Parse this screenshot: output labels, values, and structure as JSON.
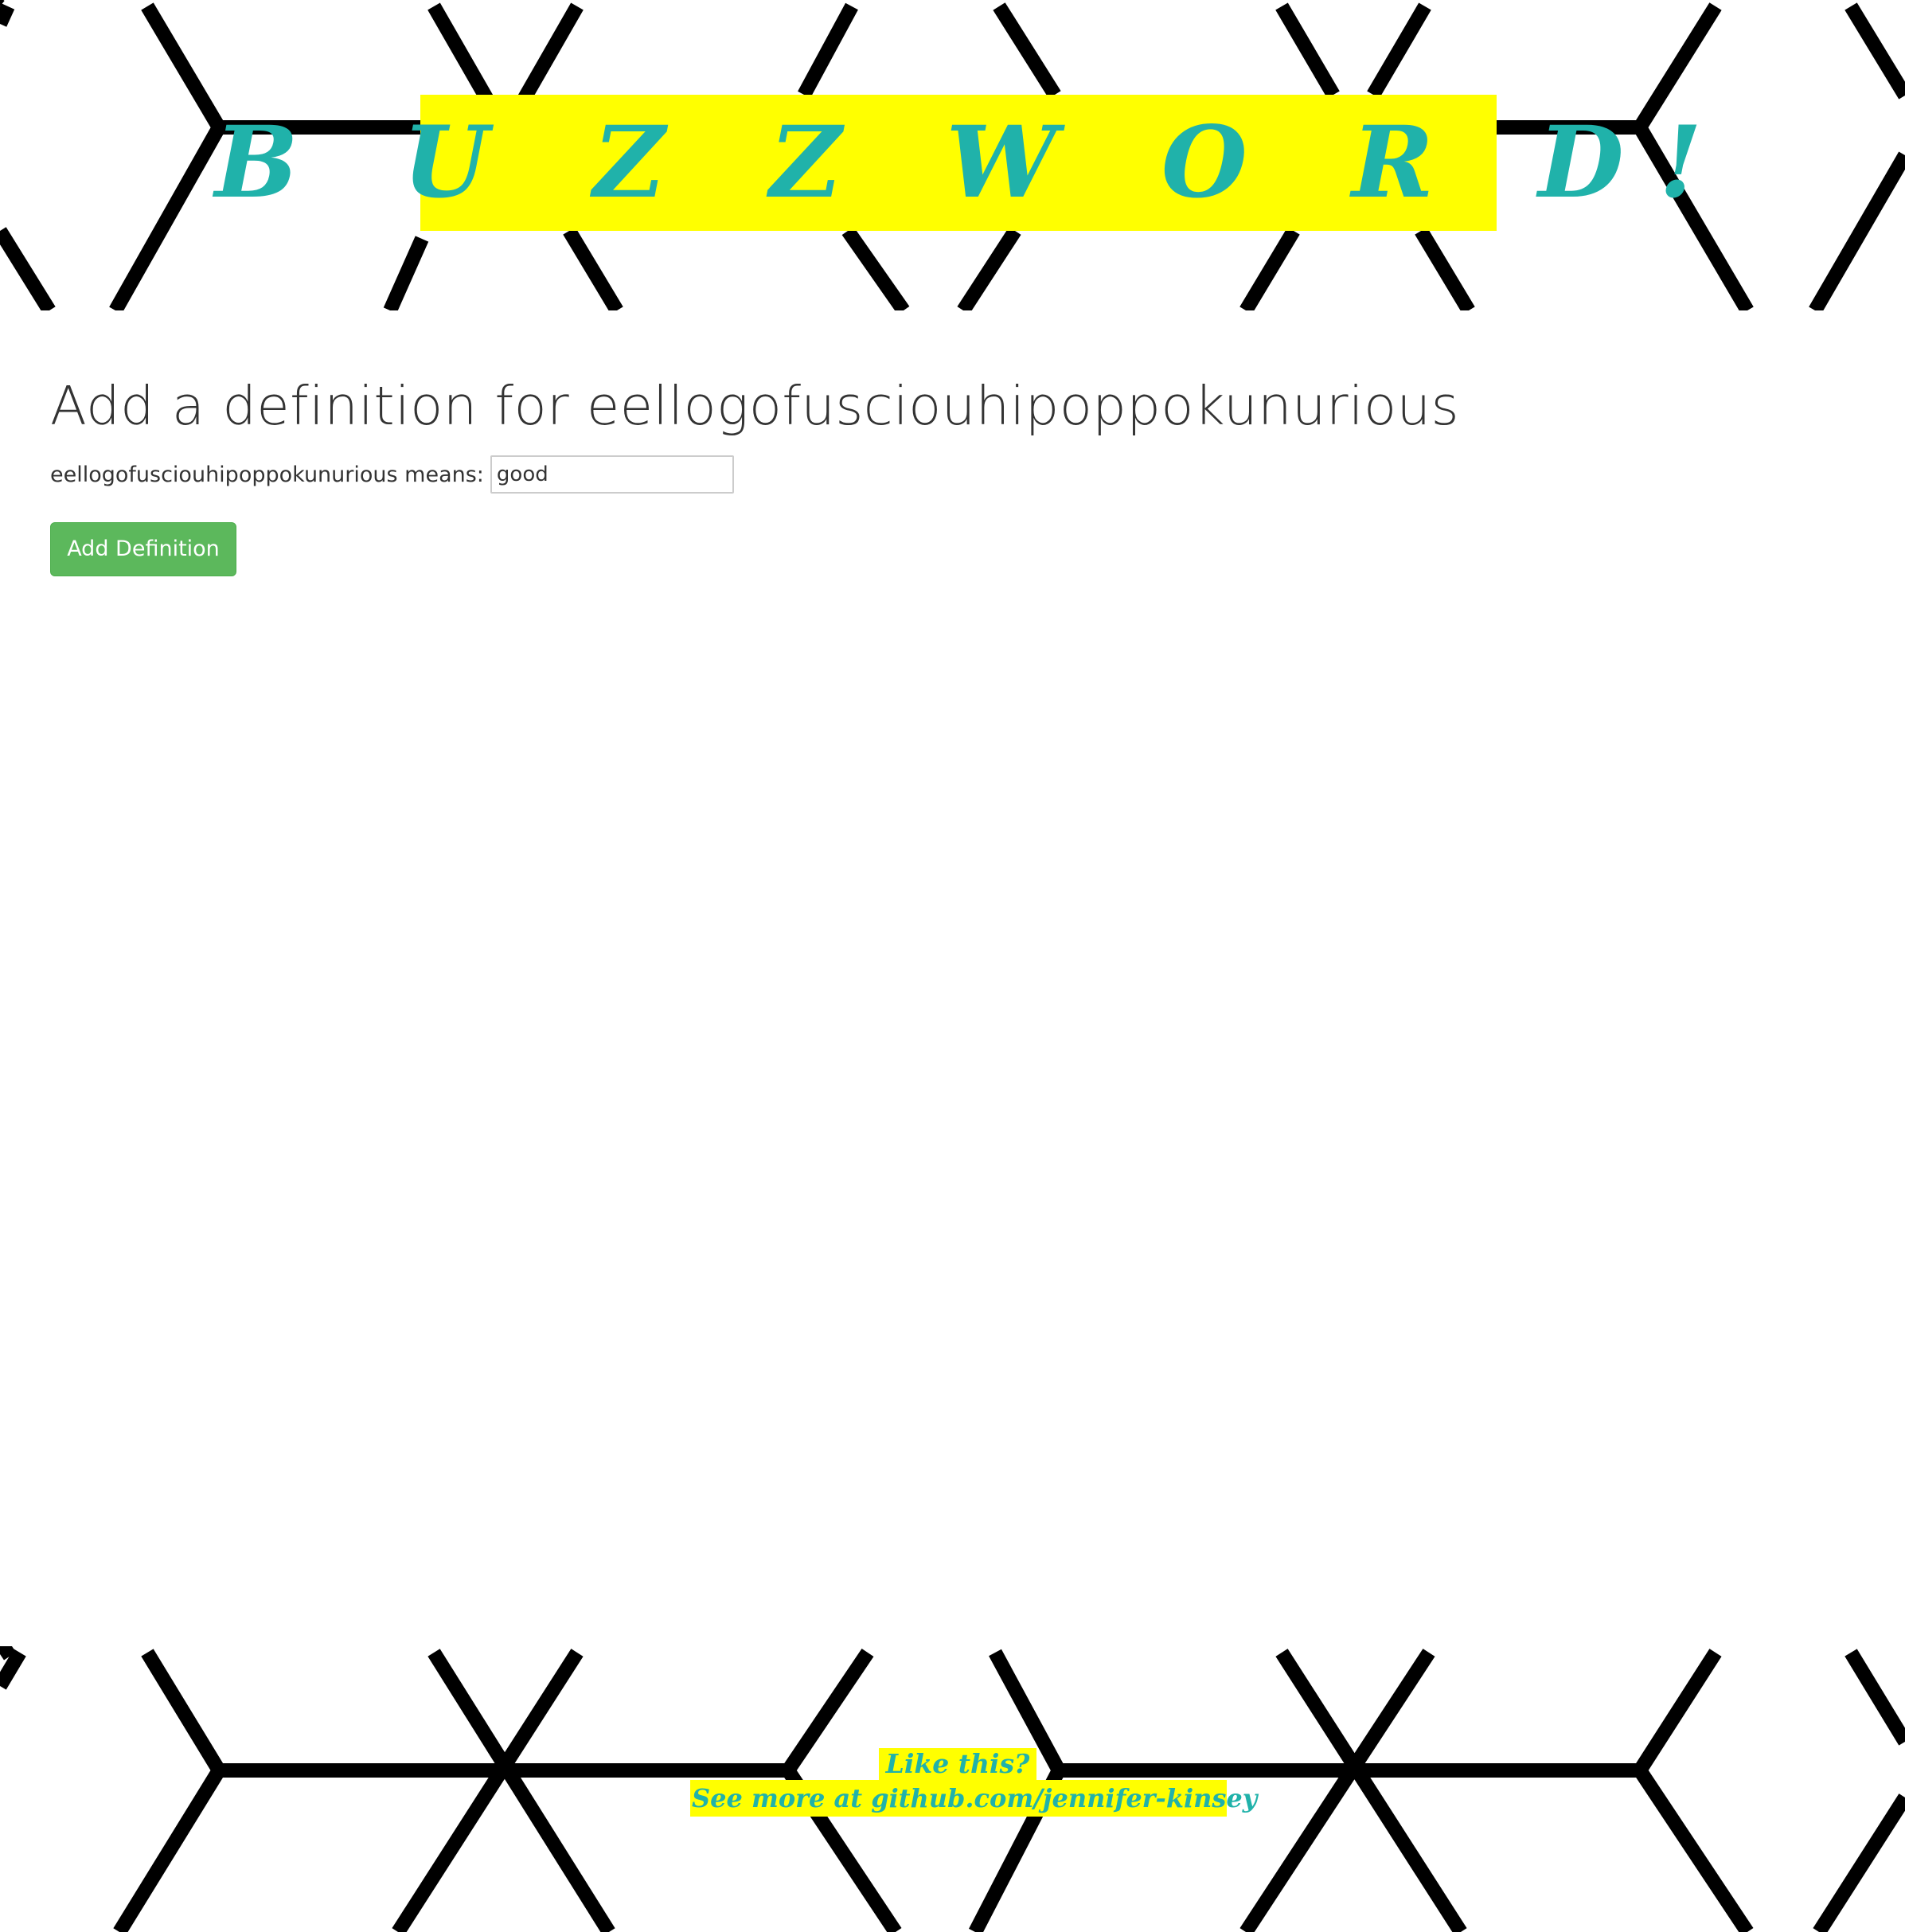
{
  "header": {
    "logo_text": "B U Z Z W O R D!"
  },
  "main": {
    "heading_prefix": "Add a definition for",
    "word": "eellogofusciouhipoppokunurious",
    "form": {
      "label_suffix": "means:",
      "input_value": "good",
      "submit_label": "Add Definition"
    }
  },
  "footer": {
    "line1": "Like this?",
    "line2": "See more at github.com/jennifer-kinsey"
  },
  "colors": {
    "accent_yellow": "#ffff00",
    "accent_teal": "#20b2aa",
    "button_green": "#5cb85c",
    "pattern_black": "#000000"
  }
}
